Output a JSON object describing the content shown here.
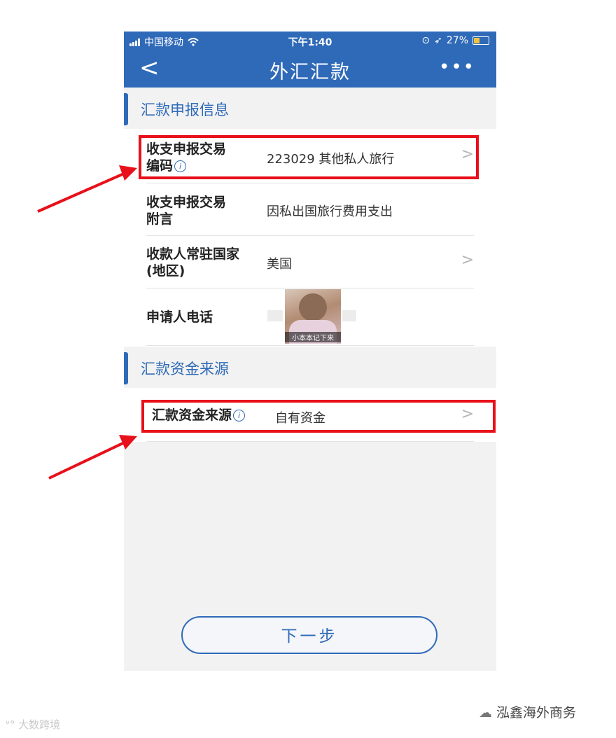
{
  "status_bar": {
    "carrier": "中国移动",
    "time": "下午1:40",
    "battery": "27%"
  },
  "nav": {
    "back_icon": "<",
    "title": "外汇汇款",
    "more_icon": "•••"
  },
  "sections": [
    {
      "title": "汇款申报信息"
    },
    {
      "title": "汇款资金来源"
    }
  ],
  "rows": [
    {
      "label_line1": "收支申报交易",
      "label_line2": "编码",
      "info_icon": "i",
      "value": "223029 其他私人旅行",
      "chevron": ">"
    },
    {
      "label_line1": "收支申报交易",
      "label_line2": "附言",
      "value": "因私出国旅行费用支出"
    },
    {
      "label_line1": "收款人常驻国家",
      "label_line2": "(地区)",
      "value": "美国",
      "chevron": ">"
    },
    {
      "label_line1": "申请人电话"
    },
    {
      "label_line1": "汇款资金来源",
      "info_icon": "i",
      "value": "自有资金",
      "chevron": ">"
    }
  ],
  "meme_caption": "小本本记下来",
  "next_button": "下一步",
  "watermark_right": "泓鑫海外商务",
  "watermark_left": "大数跨境",
  "colors": {
    "primary": "#2f6ab8",
    "highlight": "#e8101a"
  }
}
